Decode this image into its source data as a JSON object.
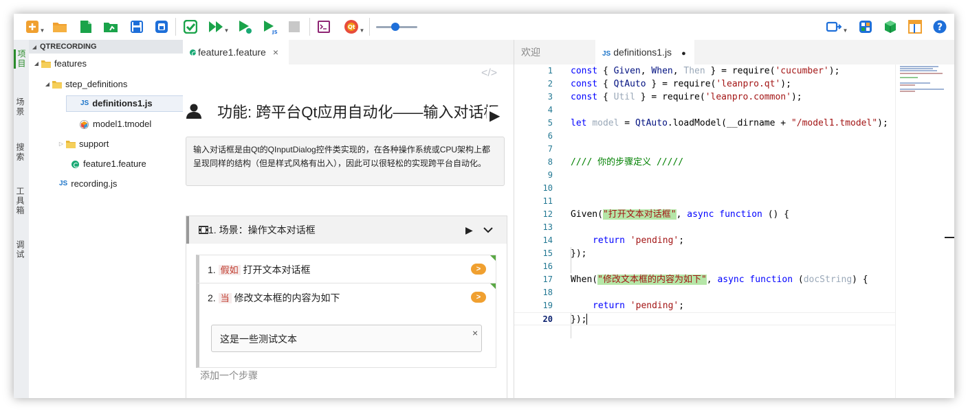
{
  "colors": {
    "accent_green": "#2a8c2a",
    "toolbar_orange": "#f0a030",
    "run_green": "#1aa34a",
    "blue": "#1e6fd9"
  },
  "toolbar": {
    "icons": [
      "new-file-icon",
      "open-folder-icon",
      "new-document-icon",
      "open-file-icon",
      "save-icon",
      "save-all-icon",
      "check-icon",
      "run-all-icon",
      "run-cucumber-icon",
      "run-js-icon",
      "stop-icon",
      "terminal-icon",
      "qt-spy-icon",
      "speed-slider",
      "record-icon",
      "layout-icon",
      "model-cube-icon",
      "panels-icon",
      "help-icon"
    ],
    "slider_value": 0.5
  },
  "side_tabs": [
    "项目",
    "场景",
    "搜索",
    "工具箱",
    "调试"
  ],
  "tree": {
    "header": "QTRECORDING",
    "items": [
      {
        "label": "features"
      },
      {
        "label": "step_definitions"
      },
      {
        "label": "definitions1.js",
        "prefix": "JS"
      },
      {
        "label": "model1.tmodel"
      },
      {
        "label": "support"
      },
      {
        "label": "feature1.feature"
      },
      {
        "label": "recording.js",
        "prefix": "JS"
      }
    ]
  },
  "middle": {
    "tab": {
      "label": "feature1.feature",
      "close": "×"
    },
    "code_toggle": "</>",
    "feature_title": "功能: 跨平台Qt应用自动化——输入对话框",
    "play": "▶",
    "description": "输入对话框是由Qt的QInputDialog控件类实现的，在各种操作系统或CPU架构上都呈现同样的结构（但是样式风格有出入），因此可以很轻松的实现跨平台自动化。",
    "scenario": {
      "title": "1. 场景：操作文本对话框",
      "steps": [
        {
          "num": "1.",
          "keyword": "假如",
          "text": "打开文本对话框",
          "button": ">"
        },
        {
          "num": "2.",
          "keyword": "当",
          "text": "修改文本框的内容为如下",
          "button": ">"
        }
      ],
      "docstring": "这是一些测试文本",
      "doc_close": "×",
      "add_step": "添加一个步骤"
    }
  },
  "editor": {
    "tabs": [
      {
        "label": "欢迎"
      },
      {
        "label": "definitions1.js",
        "prefix": "JS",
        "dirty": "●"
      }
    ],
    "line_numbers": [
      "1",
      "2",
      "3",
      "4",
      "5",
      "6",
      "7",
      "8",
      "9",
      "10",
      "11",
      "12",
      "13",
      "14",
      "15",
      "16",
      "17",
      "18",
      "19",
      "20"
    ],
    "code": {
      "l1": {
        "a": "const",
        "b": "{",
        "c": "Given",
        "d": ",",
        "e": "When",
        "f": ",",
        "g": "Then",
        "h": "} =",
        "i": "require",
        "j": "(",
        "k": "'cucumber'",
        "l": ");"
      },
      "l2": {
        "a": "const",
        "b": "{",
        "c": "QtAuto",
        "d": "} =",
        "e": "require",
        "f": "(",
        "g": "'leanpro.qt'",
        "h": ");"
      },
      "l3": {
        "a": "const",
        "b": "{",
        "c": "Util",
        "d": "} =",
        "e": "require",
        "f": "(",
        "g": "'leanpro.common'",
        "h": ");"
      },
      "l5": {
        "a": "let",
        "b": "model",
        "c": "=",
        "d": "QtAuto",
        "e": ".loadModel(__dirname +",
        "f": "\"/model1.tmodel\"",
        "g": ");"
      },
      "l8": "//// 你的步骤定义 /////",
      "l12": {
        "a": "Given(",
        "b": "\"打开文本对话框\"",
        "c": ",",
        "d": "async",
        "e": "function",
        "f": "() {"
      },
      "l14": {
        "a": "return",
        "b": "'pending'",
        "c": ";"
      },
      "l15": "});",
      "l17": {
        "a": "When(",
        "b": "\"修改文本框的内容为如下\"",
        "c": ",",
        "d": "async",
        "e": "function",
        "f": "(",
        "g": "docString",
        "h": ") {"
      },
      "l19": {
        "a": "return",
        "b": "'pending'",
        "c": ";"
      },
      "l20": "});"
    }
  }
}
